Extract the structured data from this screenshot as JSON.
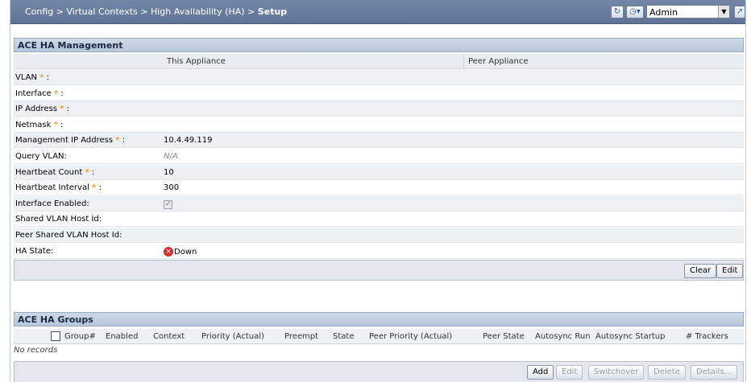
{
  "breadcrumb": {
    "path": "Config > Virtual Contexts > High Availability (HA) >",
    "current": "Setup"
  },
  "toolbar": {
    "refresh_icon": "refresh-icon",
    "clock_icon": "clock-icon",
    "user_select_value": "Admin",
    "popout_icon": "popout-icon"
  },
  "ha_management": {
    "title": "ACE HA Management",
    "col_this": "This Appliance",
    "col_peer": "Peer Appliance",
    "rows": [
      {
        "label": "VLAN",
        "required": true,
        "value": ""
      },
      {
        "label": "Interface",
        "required": true,
        "value": ""
      },
      {
        "label": "IP Address",
        "required": true,
        "value": ""
      },
      {
        "label": "Netmask",
        "required": true,
        "value": ""
      },
      {
        "label": "Management IP Address",
        "required": true,
        "value": "10.4.49.119"
      },
      {
        "label": "Query VLAN:",
        "required": false,
        "value": "N/A"
      },
      {
        "label": "Heartbeat Count",
        "required": true,
        "value": "10"
      },
      {
        "label": "Heartbeat Interval",
        "required": true,
        "value": "300"
      },
      {
        "label": "Interface Enabled:",
        "required": false,
        "value": "checked"
      },
      {
        "label": "Shared VLAN Host Id:",
        "required": false,
        "value": ""
      },
      {
        "label": "Peer Shared VLAN Host Id:",
        "required": false,
        "value": ""
      },
      {
        "label": "HA State:",
        "required": false,
        "value": "Down"
      }
    ],
    "star": "*",
    "colon": ":",
    "buttons": {
      "clear": "Clear",
      "edit": "Edit"
    }
  },
  "ha_groups": {
    "title": "ACE HA Groups",
    "columns": [
      "Group#",
      "Enabled",
      "Context",
      "Priority (Actual)",
      "Preempt",
      "State",
      "Peer Priority (Actual)",
      "Peer State",
      "Autosync Run",
      "Autosync Startup",
      "# Trackers"
    ],
    "empty_text": "No records",
    "buttons": {
      "add": "Add",
      "edit": "Edit",
      "switchover": "Switchover",
      "delete": "Delete",
      "details": "Details..."
    }
  },
  "colors": {
    "topbar": "#6a7ea1",
    "section_header": "#c4d0e1",
    "required_star": "#f3a01b",
    "down_status": "#d4312b"
  }
}
